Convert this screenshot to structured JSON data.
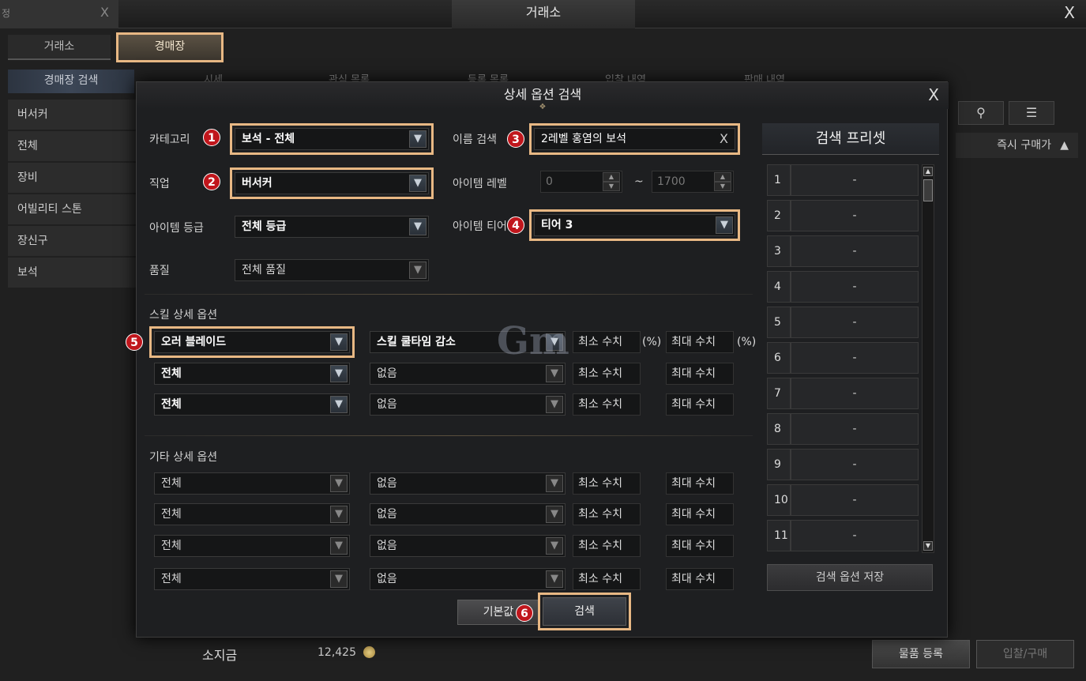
{
  "window": {
    "title": "거래소",
    "close": "X",
    "stub_title": "정",
    "stub_close": "X"
  },
  "tabs": [
    "거래소",
    "경매장"
  ],
  "sidebar": {
    "header": "경매장 검색",
    "items": [
      "버서커",
      "전체",
      "장비",
      "어빌리티 스톤",
      "장신구",
      "보석"
    ]
  },
  "subtabs": [
    "시세",
    "관심 목록",
    "등록 목록",
    "입찰 내역",
    "판매 내역"
  ],
  "bg_sort": {
    "label": "즉시 구매가",
    "arrow": "▲"
  },
  "bottom": {
    "gold_label": "소지금",
    "gold_value": "12,425",
    "register": "물품 등록",
    "bid": "입찰/구매"
  },
  "dialog": {
    "title": "상세 옵션 검색",
    "close": "X",
    "labels": {
      "category": "카테고리",
      "class": "직업",
      "grade": "아이템 등급",
      "quality": "품질",
      "name": "이름 검색",
      "level": "아이템 레벨",
      "tier": "아이템 티어"
    },
    "category_value": "보석 - 전체",
    "class_value": "버서커",
    "grade_value": "전체 등급",
    "quality_value": "전체 품질",
    "name_value": "2레벨 홍염의 보석",
    "level_min": "0",
    "level_max": "1700",
    "level_sep": "~",
    "tier_value": "티어 3",
    "skill_section": "스킬 상세 옵션",
    "skill_rows": [
      {
        "skill": "오러 블레이드",
        "option": "스킬 쿨타임 감소",
        "min": "최소 수치",
        "max": "최대 수치",
        "unit_min": "(%)",
        "unit_max": "(%)"
      },
      {
        "skill": "전체",
        "option": "없음",
        "min": "최소 수치",
        "max": "최대 수치"
      },
      {
        "skill": "전체",
        "option": "없음",
        "min": "최소 수치",
        "max": "최대 수치"
      }
    ],
    "etc_section": "기타 상세 옵션",
    "etc_rows": [
      {
        "type": "전체",
        "option": "없음",
        "min": "최소 수치",
        "max": "최대 수치"
      },
      {
        "type": "전체",
        "option": "없음",
        "min": "최소 수치",
        "max": "최대 수치"
      },
      {
        "type": "전체",
        "option": "없음",
        "min": "최소 수치",
        "max": "최대 수치"
      },
      {
        "type": "전체",
        "option": "없음",
        "min": "최소 수치",
        "max": "최대 수치"
      }
    ],
    "reset_button": "기본값",
    "search_button": "검색",
    "watermark": "Gm",
    "badges": [
      "1",
      "2",
      "3",
      "4",
      "5",
      "6"
    ]
  },
  "preset": {
    "title": "검색 프리셋",
    "items": [
      {
        "num": "1",
        "value": "-"
      },
      {
        "num": "2",
        "value": "-"
      },
      {
        "num": "3",
        "value": "-"
      },
      {
        "num": "4",
        "value": "-"
      },
      {
        "num": "5",
        "value": "-"
      },
      {
        "num": "6",
        "value": "-"
      },
      {
        "num": "7",
        "value": "-"
      },
      {
        "num": "8",
        "value": "-"
      },
      {
        "num": "9",
        "value": "-"
      },
      {
        "num": "10",
        "value": "-"
      },
      {
        "num": "11",
        "value": "-"
      }
    ],
    "save_button": "검색 옵션 저장"
  },
  "colors": {
    "highlight": "#e8b884",
    "badge": "#c0161c"
  }
}
